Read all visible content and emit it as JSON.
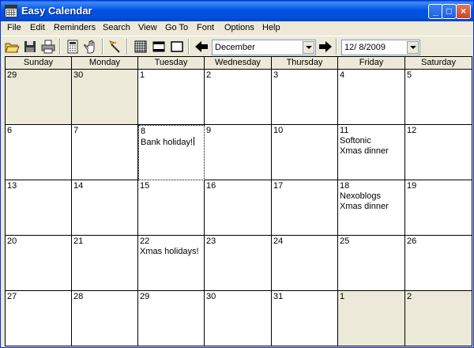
{
  "window": {
    "title": "Easy Calendar",
    "minimize_glyph": "_",
    "maximize_glyph": "□",
    "close_glyph": "×"
  },
  "menu": [
    "File",
    "Edit",
    "Reminders",
    "Search",
    "View",
    "Go To",
    "Font",
    "Options",
    "Help"
  ],
  "toolbar": {
    "icons": [
      "open-folder-icon",
      "save-icon",
      "print-icon",
      "calculator-icon",
      "hand-icon",
      "magic-wand-icon",
      "month-view-icon",
      "week-view-icon",
      "day-view-icon",
      "prev-arrow-icon",
      "next-arrow-icon"
    ],
    "month_select": "December",
    "date_field": "12/ 8/2009"
  },
  "calendar": {
    "weekdays": [
      "Sunday",
      "Monday",
      "Tuesday",
      "Wednesday",
      "Thursday",
      "Friday",
      "Saturday"
    ],
    "weeks": [
      [
        {
          "day": "29",
          "other": true,
          "events": []
        },
        {
          "day": "30",
          "other": true,
          "events": []
        },
        {
          "day": "1",
          "events": []
        },
        {
          "day": "2",
          "events": []
        },
        {
          "day": "3",
          "events": []
        },
        {
          "day": "4",
          "events": []
        },
        {
          "day": "5",
          "events": []
        }
      ],
      [
        {
          "day": "6",
          "events": []
        },
        {
          "day": "7",
          "events": []
        },
        {
          "day": "8",
          "selected": true,
          "events": [
            "Bank holiday!"
          ]
        },
        {
          "day": "9",
          "events": []
        },
        {
          "day": "10",
          "events": []
        },
        {
          "day": "11",
          "events": [
            "Softonic",
            "Xmas dinner"
          ]
        },
        {
          "day": "12",
          "events": []
        }
      ],
      [
        {
          "day": "13",
          "events": []
        },
        {
          "day": "14",
          "events": []
        },
        {
          "day": "15",
          "events": []
        },
        {
          "day": "16",
          "events": []
        },
        {
          "day": "17",
          "events": []
        },
        {
          "day": "18",
          "events": [
            "Nexoblogs",
            "Xmas dinner"
          ]
        },
        {
          "day": "19",
          "events": []
        }
      ],
      [
        {
          "day": "20",
          "events": []
        },
        {
          "day": "21",
          "events": []
        },
        {
          "day": "22",
          "events": [
            "Xmas holidays!"
          ]
        },
        {
          "day": "23",
          "events": []
        },
        {
          "day": "24",
          "events": []
        },
        {
          "day": "25",
          "events": []
        },
        {
          "day": "26",
          "events": []
        }
      ],
      [
        {
          "day": "27",
          "events": []
        },
        {
          "day": "28",
          "events": []
        },
        {
          "day": "29",
          "events": []
        },
        {
          "day": "30",
          "events": []
        },
        {
          "day": "31",
          "events": []
        },
        {
          "day": "1",
          "other": true,
          "events": []
        },
        {
          "day": "2",
          "other": true,
          "events": []
        }
      ]
    ]
  }
}
